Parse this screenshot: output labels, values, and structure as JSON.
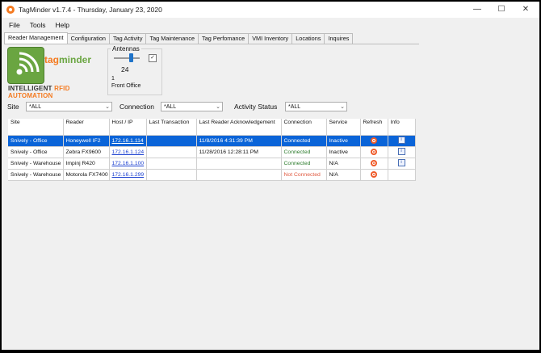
{
  "window": {
    "title": "TagMinder v1.7.4 - Thursday, January 23, 2020",
    "minimize_glyph": "—",
    "maximize_glyph": "☐",
    "close_glyph": "✕"
  },
  "menu": [
    "File",
    "Tools",
    "Help"
  ],
  "tabs": [
    "Reader Management",
    "Configuration",
    "Tag Activity",
    "Tag Maintenance",
    "Tag Perfomance",
    "VMI Inventory",
    "Locations",
    "Inquires"
  ],
  "active_tab": "Reader Management",
  "logo": {
    "brand_prefix": "tag",
    "brand_suffix": "minder",
    "tagline_1": "INTELLIGENT",
    "tagline_2": "RFID",
    "tagline_3": "AUTOMATION"
  },
  "antennas": {
    "title": "Antennas",
    "value": "24",
    "number": "1",
    "name": "Front Office",
    "checked": "✓"
  },
  "filters": {
    "site_label": "Site",
    "site_value": "*ALL",
    "connection_label": "Connection",
    "connection_value": "*ALL",
    "activity_label": "Activity Status",
    "activity_value": "*ALL"
  },
  "grid": {
    "columns": [
      "Site",
      "Reader",
      "Host / IP",
      "Last Transaction",
      "Last Reader Acknowledgement",
      "Connection",
      "Service",
      "Refresh",
      "Info"
    ],
    "rows": [
      {
        "site": "Snively - Office",
        "reader": "Honeywell IF2",
        "host": "172.16.1.114",
        "last_tx": "",
        "last_ack": "11/8/2016 4:31:39 PM",
        "connection": "Connected",
        "service": "Inactive",
        "selected": true
      },
      {
        "site": "Snively - Office",
        "reader": "Zebra FX9600",
        "host": "172.16.1.124",
        "last_tx": "",
        "last_ack": "11/28/2016 12:28:11 PM",
        "connection": "Connected",
        "service": "Inactive",
        "selected": false
      },
      {
        "site": "Snively - Warehouse",
        "reader": "Impinj R420",
        "host": "172.16.1.100",
        "last_tx": "",
        "last_ack": "",
        "connection": "Connected",
        "service": "N/A",
        "selected": false
      },
      {
        "site": "Snively - Warehouse",
        "reader": "Motorola FX7400",
        "host": "172.16.1.299",
        "last_tx": "",
        "last_ack": "",
        "connection": "Not Connected",
        "service": "N/A",
        "selected": false
      }
    ]
  },
  "icons": {
    "refresh": "refresh-icon",
    "info": "info-icon",
    "info_glyph": "i",
    "caret": "⌄"
  },
  "colors": {
    "accent_orange": "#f47a20",
    "brand_green": "#6aa541",
    "selection_blue": "#0a64d8",
    "connected_green": "#2a7a2a",
    "not_connected_red": "#e05a40"
  }
}
